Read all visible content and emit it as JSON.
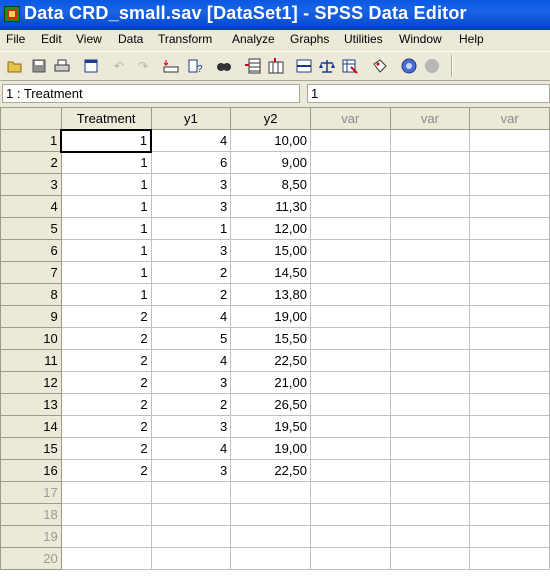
{
  "window": {
    "title": "Data CRD_small.sav [DataSet1] - SPSS Data Editor"
  },
  "menu": [
    "File",
    "Edit",
    "View",
    "Data",
    "Transform",
    "Analyze",
    "Graphs",
    "Utilities",
    "Window",
    "Help"
  ],
  "toolbar_icons": [
    "open-icon",
    "save-icon",
    "print-icon",
    "dialog-recall-icon",
    "undo-icon",
    "redo-icon",
    "goto-case-icon",
    "variables-icon",
    "find-icon",
    "insert-cases-icon",
    "insert-variable-icon",
    "split-file-icon",
    "weight-cases-icon",
    "select-cases-icon",
    "value-labels-icon",
    "use-sets-icon",
    "show-all-icon"
  ],
  "cellbar": {
    "name": "1 : Treatment",
    "value": "1"
  },
  "columns": [
    "Treatment",
    "y1",
    "y2",
    "var",
    "var",
    "var"
  ],
  "rows": [
    [
      "1",
      "1",
      "4",
      "10,00"
    ],
    [
      "2",
      "1",
      "6",
      "9,00"
    ],
    [
      "3",
      "1",
      "3",
      "8,50"
    ],
    [
      "4",
      "1",
      "3",
      "11,30"
    ],
    [
      "5",
      "1",
      "1",
      "12,00"
    ],
    [
      "6",
      "1",
      "3",
      "15,00"
    ],
    [
      "7",
      "1",
      "2",
      "14,50"
    ],
    [
      "8",
      "1",
      "2",
      "13,80"
    ],
    [
      "9",
      "2",
      "4",
      "19,00"
    ],
    [
      "10",
      "2",
      "5",
      "15,50"
    ],
    [
      "11",
      "2",
      "4",
      "22,50"
    ],
    [
      "12",
      "2",
      "3",
      "21,00"
    ],
    [
      "13",
      "2",
      "2",
      "26,50"
    ],
    [
      "14",
      "2",
      "3",
      "19,50"
    ],
    [
      "15",
      "2",
      "4",
      "19,00"
    ],
    [
      "16",
      "2",
      "3",
      "22,50"
    ]
  ],
  "empty_rows": [
    "17",
    "18",
    "19",
    "20"
  ]
}
